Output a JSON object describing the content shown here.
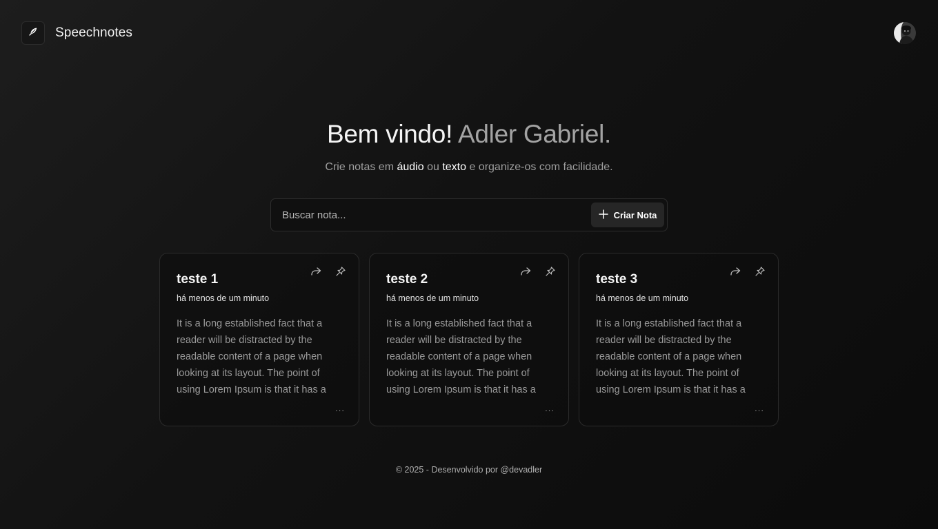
{
  "header": {
    "app_name": "Speechnotes",
    "logo_icon": "feather-icon",
    "avatar_icon": "user-avatar"
  },
  "hero": {
    "greeting": "Bem vindo!",
    "user_name": "Adler Gabriel.",
    "sub_before": "Crie notas em ",
    "sub_audio": "áudio",
    "sub_mid": " ou ",
    "sub_text": "texto",
    "sub_after": " e organize-os com facilidade."
  },
  "search": {
    "placeholder": "Buscar nota...",
    "value": "",
    "create_label": "Criar Nota",
    "create_icon": "plus-icon"
  },
  "notes": [
    {
      "title": "teste 1",
      "time": "há menos de um minuto",
      "body": "It is a long established fact that a reader will be distracted by the readable content of a page when looking at its layout. The point of using Lorem Ipsum is that it has a",
      "more": "..."
    },
    {
      "title": "teste 2",
      "time": "há menos de um minuto",
      "body": "It is a long established fact that a reader will be distracted by the readable content of a page when looking at its layout. The point of using Lorem Ipsum is that it has a",
      "more": "..."
    },
    {
      "title": "teste 3",
      "time": "há menos de um minuto",
      "body": "It is a long established fact that a reader will be distracted by the readable content of a page when looking at its layout. The point of using Lorem Ipsum is that it has a",
      "more": "..."
    }
  ],
  "note_icons": [
    "share-icon",
    "pin-icon"
  ],
  "footer": {
    "text": "© 2025 - Desenvolvido por @devadler"
  },
  "colors": {
    "background": "#121212",
    "muted_text": "#9e9e9e",
    "border": "#2b2b2b"
  }
}
